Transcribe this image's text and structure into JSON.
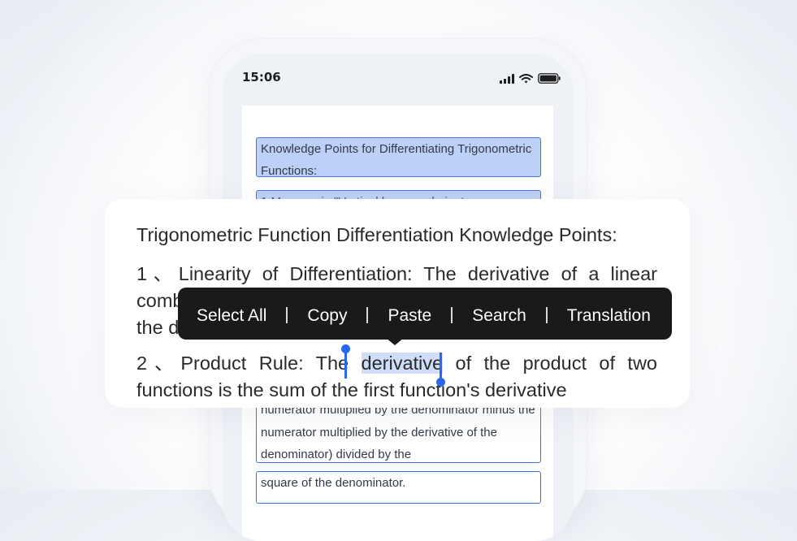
{
  "status_bar": {
    "time": "15:06"
  },
  "document": {
    "blocks": [
      {
        "text": "Knowledge Points for Differentiating Trigonometric Functions:"
      },
      {
        "text": "1 Managasia \"Vertical h... sample i... t..."
      },
      {
        "text": "numerator multiplied by the denominator minus the numerator multiplied by the derivative of the denominator) divided by the"
      },
      {
        "text": "square of the denominator."
      }
    ]
  },
  "popup": {
    "heading": "Trigonometric Function Differentiation Knowledge Points:",
    "para1": "1、Linearity of Differentiation: The derivative of a linear combination of functions is equal to the linear combination of the derivatives of each part.",
    "para2_before": "2、Product Rule: The ",
    "para2_selected": "derivative",
    "para2_after": " of the product of two functions is the sum of the first function's derivative"
  },
  "context_menu": {
    "items": [
      "Select All",
      "Copy",
      "Paste",
      "Search",
      "Translation"
    ]
  },
  "colors": {
    "accent": "#2867ee",
    "selection": "#cfdcfa",
    "menu_bg": "#1a1a1a"
  }
}
